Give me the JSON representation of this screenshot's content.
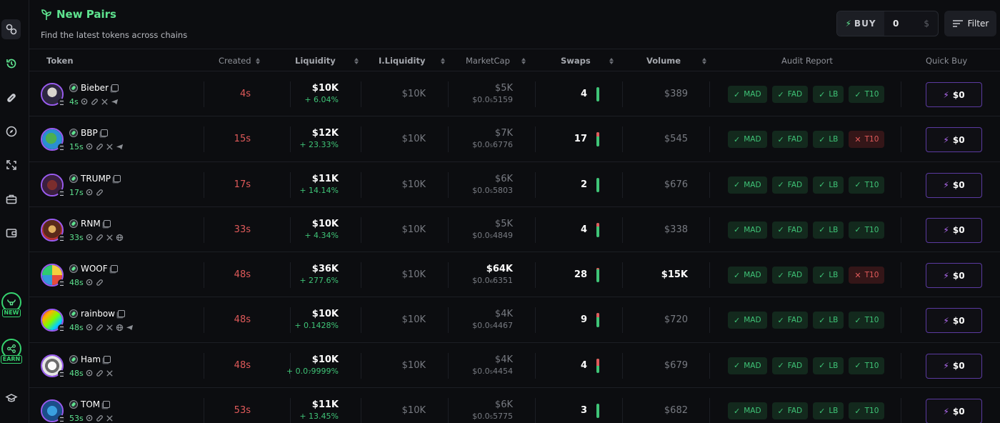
{
  "header": {
    "title": "New Pairs",
    "subtitle": "Find the latest tokens across chains",
    "buy_label": "BUY",
    "buy_amount": "0",
    "buy_currency": "$",
    "filter_label": "Filter"
  },
  "columns": {
    "token": "Token",
    "created": "Created",
    "liquidity": "Liquidity",
    "initial_liquidity": "I.Liquidity",
    "market_cap": "MarketCap",
    "swaps": "Swaps",
    "volume": "Volume",
    "audit": "Audit Report",
    "quick_buy": "Quick Buy"
  },
  "sidebar": {
    "promo_new": "NEW",
    "promo_earn": "EARN"
  },
  "colors": {
    "accent_green": "#5ee38f",
    "positive": "#3fc477",
    "negative": "#e05a5a",
    "quick_buy_border": "#5b3aa0"
  },
  "rows": [
    {
      "name": "Bieber",
      "age": "4s",
      "socials": [
        "search",
        "link",
        "x",
        "telegram"
      ],
      "created": "4s",
      "liquidity": "$10K",
      "liq_change": "+ 6.04%",
      "initial_liquidity": "$10K",
      "market_cap": "$5K",
      "price": "$0.0₅5159",
      "swaps": "4",
      "sell_share": 0,
      "volume": "$389",
      "audits": [
        {
          "label": "MAD",
          "ok": true
        },
        {
          "label": "FAD",
          "ok": true
        },
        {
          "label": "LB",
          "ok": true
        },
        {
          "label": "T10",
          "ok": true
        }
      ],
      "quick_buy": "$0"
    },
    {
      "name": "BBP",
      "age": "15s",
      "socials": [
        "search",
        "link",
        "x",
        "telegram"
      ],
      "created": "15s",
      "liquidity": "$12K",
      "liq_change": "+ 23.33%",
      "initial_liquidity": "$10K",
      "market_cap": "$7K",
      "price": "$0.0₅6776",
      "swaps": "17",
      "sell_share": 0.3,
      "volume": "$545",
      "audits": [
        {
          "label": "MAD",
          "ok": true
        },
        {
          "label": "FAD",
          "ok": true
        },
        {
          "label": "LB",
          "ok": true
        },
        {
          "label": "T10",
          "ok": false
        }
      ],
      "quick_buy": "$0"
    },
    {
      "name": "TRUMP",
      "age": "17s",
      "socials": [
        "search",
        "link"
      ],
      "created": "17s",
      "liquidity": "$11K",
      "liq_change": "+ 14.14%",
      "initial_liquidity": "$10K",
      "market_cap": "$6K",
      "price": "$0.0₅5803",
      "swaps": "2",
      "sell_share": 0,
      "volume": "$676",
      "audits": [
        {
          "label": "MAD",
          "ok": true
        },
        {
          "label": "FAD",
          "ok": true
        },
        {
          "label": "LB",
          "ok": true
        },
        {
          "label": "T10",
          "ok": true
        }
      ],
      "quick_buy": "$0"
    },
    {
      "name": "RNM",
      "age": "33s",
      "socials": [
        "search",
        "link",
        "x",
        "web"
      ],
      "created": "33s",
      "liquidity": "$10K",
      "liq_change": "+ 4.34%",
      "initial_liquidity": "$10K",
      "market_cap": "$5K",
      "price": "$0.0₅4849",
      "swaps": "4",
      "sell_share": 0.25,
      "volume": "$338",
      "audits": [
        {
          "label": "MAD",
          "ok": true
        },
        {
          "label": "FAD",
          "ok": true
        },
        {
          "label": "LB",
          "ok": true
        },
        {
          "label": "T10",
          "ok": true
        }
      ],
      "quick_buy": "$0"
    },
    {
      "name": "WOOF",
      "age": "48s",
      "socials": [
        "search",
        "link"
      ],
      "created": "48s",
      "liquidity": "$36K",
      "liq_change": "+ 277.6%",
      "initial_liquidity": "$10K",
      "market_cap": "$64K",
      "price": "$0.0₆6351",
      "swaps": "28",
      "sell_share": 0.1,
      "volume": "$15K",
      "audits": [
        {
          "label": "MAD",
          "ok": true
        },
        {
          "label": "FAD",
          "ok": true
        },
        {
          "label": "LB",
          "ok": true
        },
        {
          "label": "T10",
          "ok": false
        }
      ],
      "quick_buy": "$0"
    },
    {
      "name": "rainbow",
      "age": "48s",
      "socials": [
        "search",
        "link",
        "x",
        "web",
        "telegram"
      ],
      "created": "48s",
      "liquidity": "$10K",
      "liq_change": "+ 0.1428%",
      "initial_liquidity": "$10K",
      "market_cap": "$4K",
      "price": "$0.0₅4467",
      "swaps": "9",
      "sell_share": 0.3,
      "volume": "$720",
      "audits": [
        {
          "label": "MAD",
          "ok": true
        },
        {
          "label": "FAD",
          "ok": true
        },
        {
          "label": "LB",
          "ok": true
        },
        {
          "label": "T10",
          "ok": true
        }
      ],
      "quick_buy": "$0"
    },
    {
      "name": "Ham",
      "age": "48s",
      "socials": [
        "search",
        "link",
        "x"
      ],
      "created": "48s",
      "liquidity": "$10K",
      "liq_change": "+ 0.0₇9999%",
      "initial_liquidity": "$10K",
      "market_cap": "$4K",
      "price": "$0.0₅4454",
      "swaps": "4",
      "sell_share": 0.5,
      "volume": "$679",
      "audits": [
        {
          "label": "MAD",
          "ok": true
        },
        {
          "label": "FAD",
          "ok": true
        },
        {
          "label": "LB",
          "ok": true
        },
        {
          "label": "T10",
          "ok": true
        }
      ],
      "quick_buy": "$0"
    },
    {
      "name": "TOM",
      "age": "53s",
      "socials": [
        "search",
        "link",
        "x"
      ],
      "created": "53s",
      "liquidity": "$11K",
      "liq_change": "+ 13.45%",
      "initial_liquidity": "$10K",
      "market_cap": "$6K",
      "price": "$0.0₅5775",
      "swaps": "3",
      "sell_share": 0,
      "volume": "$682",
      "audits": [
        {
          "label": "MAD",
          "ok": true
        },
        {
          "label": "FAD",
          "ok": true
        },
        {
          "label": "LB",
          "ok": true
        },
        {
          "label": "T10",
          "ok": true
        }
      ],
      "quick_buy": "$0"
    }
  ]
}
